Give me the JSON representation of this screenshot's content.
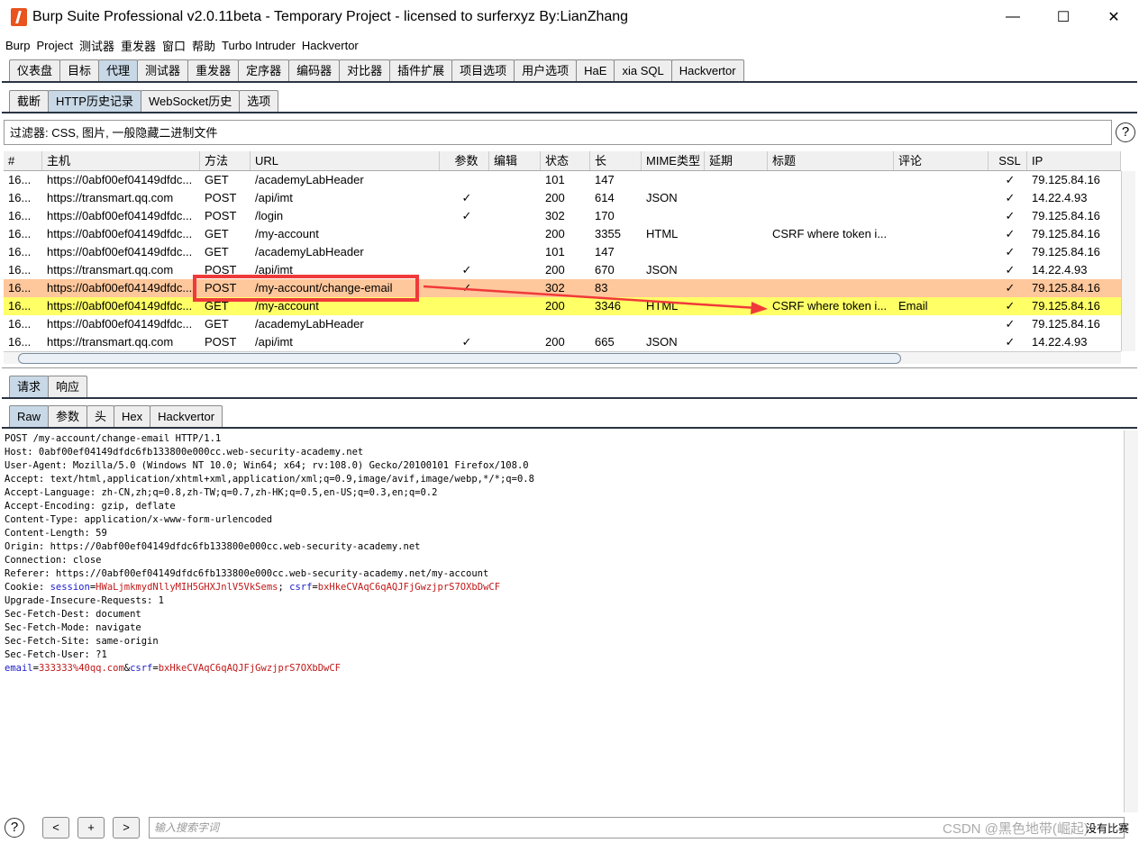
{
  "window": {
    "title": "Burp Suite Professional v2.0.11beta - Temporary Project - licensed to surferxyz By:LianZhang",
    "minimize": "—",
    "maximize": "☐",
    "close": "✕"
  },
  "menu": [
    "Burp",
    "Project",
    "测试器",
    "重发器",
    "窗口",
    "帮助",
    "Turbo Intruder",
    "Hackvertor"
  ],
  "main_tabs": [
    "仪表盘",
    "目标",
    "代理",
    "测试器",
    "重发器",
    "定序器",
    "编码器",
    "对比器",
    "插件扩展",
    "项目选项",
    "用户选项",
    "HaE",
    "xia SQL",
    "Hackvertor"
  ],
  "proxy_tabs": [
    "截断",
    "HTTP历史记录",
    "WebSocket历史",
    "选项"
  ],
  "filter": "过滤器: CSS, 图片, 一般隐藏二进制文件",
  "help": "?",
  "columns": [
    "#",
    "主机",
    "方法",
    "URL",
    "参数",
    "编辑",
    "状态",
    "长",
    "MIME类型",
    "延期",
    "标题",
    "评论",
    "SSL",
    "IP"
  ],
  "sort_icon": "▲",
  "rows": [
    [
      "16...",
      "https://0abf00ef04149dfdc...",
      "GET",
      "/academyLabHeader",
      "",
      "",
      "101",
      "147",
      "",
      "",
      "",
      "",
      "✓",
      "79.125.84.16"
    ],
    [
      "16...",
      "https://transmart.qq.com",
      "POST",
      "/api/imt",
      "✓",
      "",
      "200",
      "614",
      "JSON",
      "",
      "",
      "",
      "✓",
      "14.22.4.93"
    ],
    [
      "16...",
      "https://0abf00ef04149dfdc...",
      "POST",
      "/login",
      "✓",
      "",
      "302",
      "170",
      "",
      "",
      "",
      "",
      "✓",
      "79.125.84.16"
    ],
    [
      "16...",
      "https://0abf00ef04149dfdc...",
      "GET",
      "/my-account",
      "",
      "",
      "200",
      "3355",
      "HTML",
      "",
      "CSRF where token i...",
      "",
      "✓",
      "79.125.84.16"
    ],
    [
      "16...",
      "https://0abf00ef04149dfdc...",
      "GET",
      "/academyLabHeader",
      "",
      "",
      "101",
      "147",
      "",
      "",
      "",
      "",
      "✓",
      "79.125.84.16"
    ],
    [
      "16...",
      "https://transmart.qq.com",
      "POST",
      "/api/imt",
      "✓",
      "",
      "200",
      "670",
      "JSON",
      "",
      "",
      "",
      "✓",
      "14.22.4.93"
    ],
    [
      "16...",
      "https://0abf00ef04149dfdc...",
      "POST",
      "/my-account/change-email",
      "✓",
      "",
      "302",
      "83",
      "",
      "",
      "",
      "",
      "✓",
      "79.125.84.16"
    ],
    [
      "16...",
      "https://0abf00ef04149dfdc...",
      "GET",
      "/my-account",
      "",
      "",
      "200",
      "3346",
      "HTML",
      "",
      "CSRF where token i...",
      "Email",
      "✓",
      "79.125.84.16"
    ],
    [
      "16...",
      "https://0abf00ef04149dfdc...",
      "GET",
      "/academyLabHeader",
      "",
      "",
      "",
      "",
      "",
      "",
      "",
      "",
      "✓",
      "79.125.84.16"
    ],
    [
      "16...",
      "https://transmart.qq.com",
      "POST",
      "/api/imt",
      "✓",
      "",
      "200",
      "665",
      "JSON",
      "",
      "",
      "",
      "✓",
      "14.22.4.93"
    ]
  ],
  "row_highlight": {
    "6": "#ffc79c",
    "7": "#ffff66"
  },
  "msg_tabs": [
    "请求",
    "响应"
  ],
  "view_tabs": [
    "Raw",
    "参数",
    "头",
    "Hex",
    "Hackvertor"
  ],
  "request_lines": [
    "POST /my-account/change-email HTTP/1.1",
    "Host: 0abf00ef04149dfdc6fb133800e000cc.web-security-academy.net",
    "User-Agent: Mozilla/5.0 (Windows NT 10.0; Win64; x64; rv:108.0) Gecko/20100101 Firefox/108.0",
    "Accept: text/html,application/xhtml+xml,application/xml;q=0.9,image/avif,image/webp,*/*;q=0.8",
    "Accept-Language: zh-CN,zh;q=0.8,zh-TW;q=0.7,zh-HK;q=0.5,en-US;q=0.3,en;q=0.2",
    "Accept-Encoding: gzip, deflate",
    "Content-Type: application/x-www-form-urlencoded",
    "Content-Length: 59",
    "Origin: https://0abf00ef04149dfdc6fb133800e000cc.web-security-academy.net",
    "Connection: close",
    "Referer: https://0abf00ef04149dfdc6fb133800e000cc.web-security-academy.net/my-account"
  ],
  "cookie": {
    "prefix": "Cookie: ",
    "k1": "session",
    "v1": "HWaLjmkmydNllyMIH5GHXJnlV5VkSems",
    "sep": "; ",
    "k2": "csrf",
    "v2": "bxHkeCVAqC6qAQJFjGwzjprS7OXbDwCF"
  },
  "request_lines2": [
    "Upgrade-Insecure-Requests: 1",
    "Sec-Fetch-Dest: document",
    "Sec-Fetch-Mode: navigate",
    "Sec-Fetch-Site: same-origin",
    "Sec-Fetch-User: ?1",
    ""
  ],
  "body": {
    "k1": "email",
    "v1": "333333%40qq.com",
    "k2": "csrf",
    "v2": "bxHkeCVAqC6qAQJFjGwzjprS7OXbDwCF"
  },
  "search": {
    "placeholder": "输入搜索字词",
    "prev": "<",
    "add": ">",
    "plus": "+",
    "matches": "没有比赛"
  },
  "watermark": "CSDN @黑色地带(崛起)"
}
